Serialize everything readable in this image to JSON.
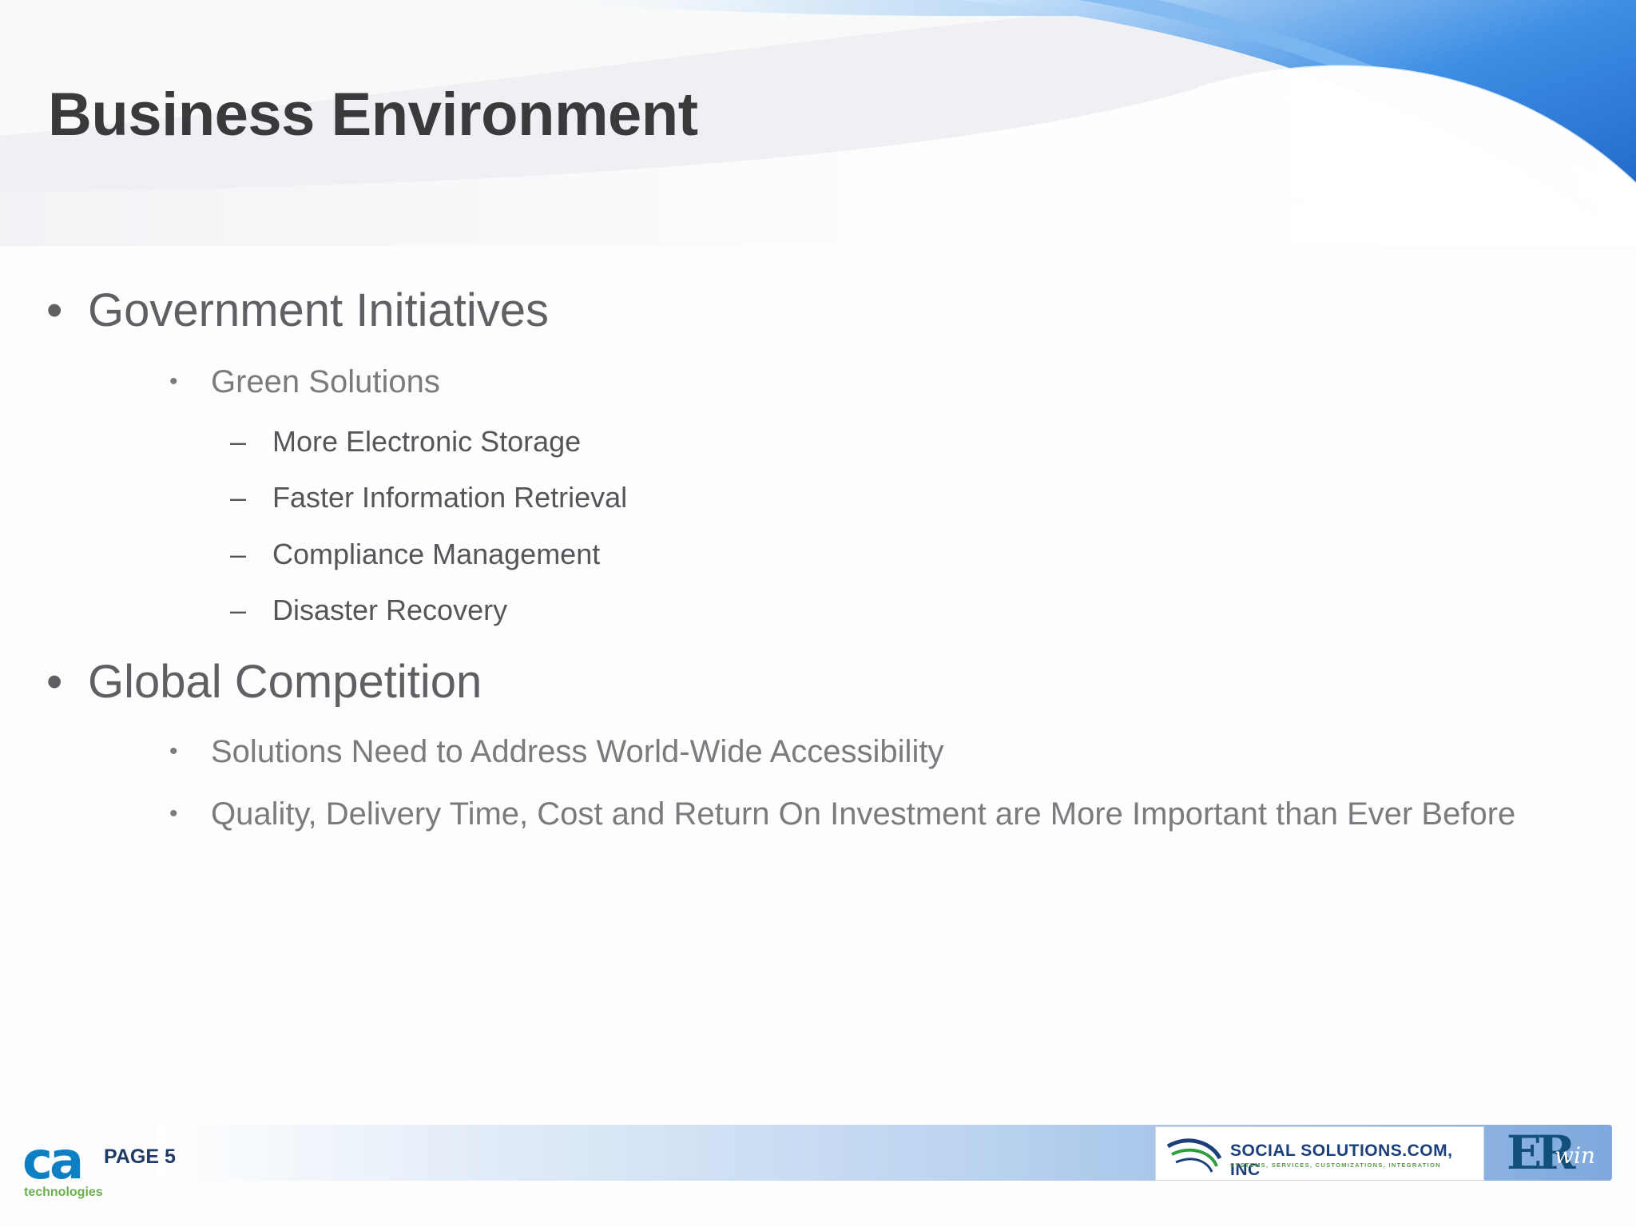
{
  "slide": {
    "title": "Business Environment"
  },
  "content": {
    "sections": [
      {
        "label": "Government Initiatives",
        "items": [
          {
            "label": "Green Solutions",
            "subitems": [
              "More Electronic Storage",
              "Faster Information Retrieval",
              "Compliance Management",
              "Disaster Recovery"
            ]
          }
        ]
      },
      {
        "label": "Global Competition",
        "items": [
          {
            "label": "Solutions Need to Address World-Wide Accessibility"
          },
          {
            "label": "Quality, Delivery Time, Cost and Return On Investment are More Important than Ever Before"
          }
        ]
      }
    ],
    "bullet_glyph": "•",
    "dash_glyph": "–"
  },
  "footer": {
    "page_label": "PAGE 5",
    "ca_logo_mark": "ca",
    "ca_logo_text": "technologies",
    "partner_name": "SOCIAL SOLUTIONS.COM, INC",
    "partner_tagline": "SYSTEMS, SERVICES, CUSTOMIZATIONS, INTEGRATION",
    "product_logo_main": "ER",
    "product_logo_script": "win"
  },
  "colors": {
    "title": "#3a3a3c",
    "accent_blue": "#2f7fd6",
    "ca_blue": "#0e7fc2",
    "ca_green": "#6ab04c"
  }
}
